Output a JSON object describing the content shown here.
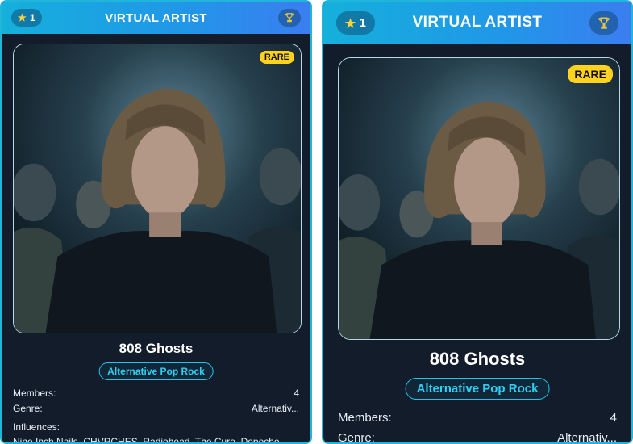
{
  "card": {
    "title": "VIRTUAL ARTIST",
    "level": "1",
    "rarity": "RARE",
    "artist_name": "808 Ghosts",
    "genre_tag": "Alternative Pop Rock",
    "members_label": "Members:",
    "members_value": "4",
    "genre_label": "Genre:",
    "genre_value": "Alternativ...",
    "influences_label": "Influences:",
    "influences_value": "Nine Inch Nails, CHVRCHES, Radiohead, The Cure, Depeche"
  },
  "icons": {
    "level": "star-icon",
    "achievement": "trophy-icon"
  },
  "colors": {
    "header_start": "#15b0dc",
    "header_end": "#3b7df0",
    "accent": "#22c3ea",
    "rare": "#ffd21f",
    "card_bg": "#121c2b"
  }
}
